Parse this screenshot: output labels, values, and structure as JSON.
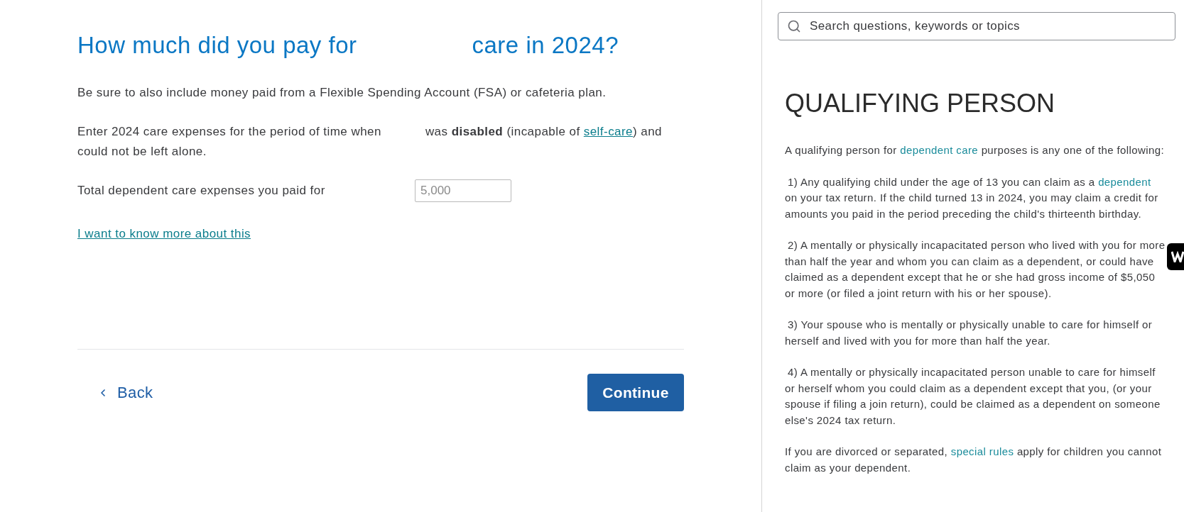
{
  "question": {
    "heading": [
      {
        "kind": "text",
        "text": "How much did you pay for"
      },
      {
        "kind": "redacted"
      },
      {
        "kind": "text",
        "text": "care in 2024?"
      }
    ],
    "intro": "Be sure to also include money paid from a Flexible Spending Account (FSA) or cafeteria plan.",
    "note": [
      {
        "kind": "text",
        "text": "Enter 2024 care expenses for the period of time when"
      },
      {
        "kind": "redacted"
      },
      {
        "kind": "text",
        "text": "was **disabled** (incapable of "
      },
      {
        "kind": "link",
        "text": "self-care"
      },
      {
        "kind": "text",
        "text": ") and could not be left alone."
      }
    ],
    "amount_field": {
      "label": "Total dependent care expenses you paid for",
      "placeholder": "5,000"
    },
    "more_link": "I want to know more about this"
  },
  "navigation": {
    "back": "Back",
    "continue": "Continue"
  },
  "help_panel": {
    "search": {
      "placeholder": "Search questions, keywords or topics"
    },
    "title": "QUALIFYING PERSON",
    "paragraphs": [
      {
        "kind": "lead",
        "parts": [
          {
            "kind": "text",
            "text": "A qualifying person for "
          },
          {
            "kind": "link",
            "text": "dependent care"
          },
          {
            "kind": "text",
            "text": " purposes is any one of the following:"
          }
        ]
      },
      {
        "kind": "item",
        "parts": [
          {
            "kind": "text",
            "text": "1) Any qualifying child under the age of 13 you can claim as a "
          },
          {
            "kind": "link",
            "text": "dependent"
          },
          {
            "kind": "text",
            "text": " on your tax return. If the child turned 13 in 2024, you may claim a credit for amounts you paid in the period preceding the child's thirteenth birthday."
          }
        ]
      },
      {
        "kind": "item",
        "parts": [
          {
            "kind": "text",
            "text": "2) A mentally or physically incapacitated person who lived with you for more than half the year and whom you can claim as a dependent, or could have claimed as a dependent except that he or she had gross income of $5,050 or more (or filed a joint return with his or her spouse)."
          }
        ]
      },
      {
        "kind": "item",
        "parts": [
          {
            "kind": "text",
            "text": "3) Your spouse who is mentally or physically unable to care for himself or herself and lived with you for more than half the year."
          }
        ]
      },
      {
        "kind": "item",
        "parts": [
          {
            "kind": "text",
            "text": "4) A mentally or physically incapacitated person unable to care for himself or herself whom you could claim as a dependent except that you, (or your spouse if filing a join return), could be claimed as a dependent on someone else's 2024 tax return."
          }
        ]
      },
      {
        "kind": "note",
        "parts": [
          {
            "kind": "text",
            "text": "If you are divorced or separated, "
          },
          {
            "kind": "link",
            "text": "special rules"
          },
          {
            "kind": "text",
            "text": " apply for children you cannot claim as your dependent."
          }
        ]
      }
    ]
  }
}
